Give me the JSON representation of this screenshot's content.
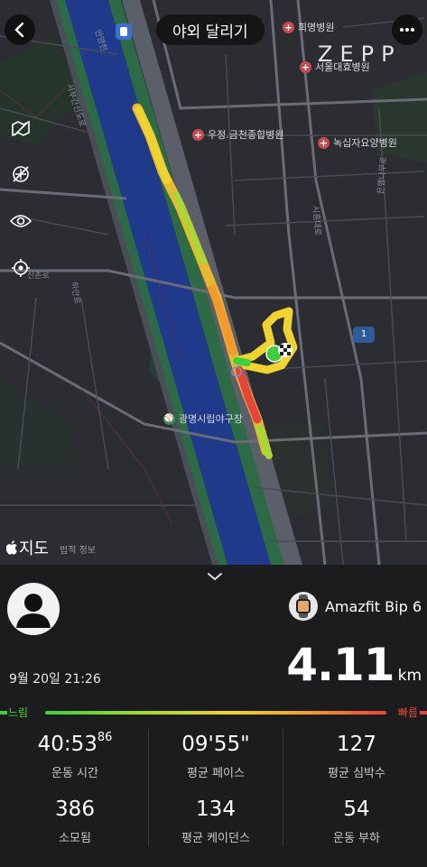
{
  "header": {
    "title": "야외 달리기",
    "back_icon": "chevron-left-icon",
    "more_icon": "ellipsis-icon"
  },
  "map": {
    "brand_watermark": "ZEPP",
    "pois": {
      "hospital_1": "희명병원",
      "hospital_2": "서울대효병원",
      "hospital_3": "우정.금천종합병원",
      "hospital_4": "녹십자요양병원",
      "stadium": "광명시립야구장"
    },
    "road_labels": {
      "road_a": "안양천",
      "road_b": "서부간선도로",
      "road_c": "신촌로",
      "road_d": "은행나무로",
      "road_e": "시흥대로",
      "road_f": "하안로"
    },
    "route_shield": "1",
    "attribution": "지도",
    "legal": "법적 정보",
    "tools": [
      "map-type-icon",
      "no-layers-icon",
      "visibility-icon",
      "locate-icon"
    ]
  },
  "summary": {
    "device_name": "Amazfit Bip 6",
    "date": "9월 20일 21:26",
    "distance_value": "4.11",
    "distance_unit": "km",
    "pace_scale": {
      "slow_label": "느림",
      "fast_label": "빠름",
      "colors": [
        "#3ecf3a",
        "#a7d834",
        "#f1d330",
        "#f39a2b",
        "#e8433a"
      ]
    },
    "stats": [
      {
        "value": "40:53",
        "suffix": "86",
        "label": "운동 시간"
      },
      {
        "value": "09'55\"",
        "suffix": "",
        "label": "평균 페이스"
      },
      {
        "value": "127",
        "suffix": "",
        "label": "평균 심박수"
      },
      {
        "value": "386",
        "suffix": "",
        "label": "소모됨"
      },
      {
        "value": "134",
        "suffix": "",
        "label": "평균 케이던스"
      },
      {
        "value": "54",
        "suffix": "",
        "label": "운동 부하"
      }
    ]
  }
}
